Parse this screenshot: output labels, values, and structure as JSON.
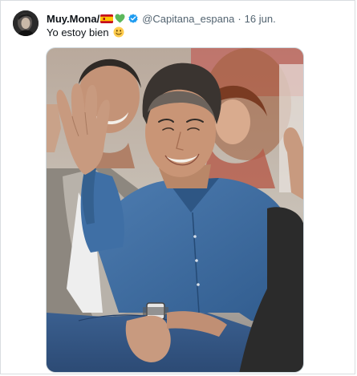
{
  "tweet": {
    "display_name": "Muy.Mona/",
    "handle": "@Capitana_espana",
    "separator": "·",
    "date": "16 jun.",
    "text": "Yo estoy bien",
    "name_emojis": [
      "spain-flag-emoji",
      "green-heart-emoji"
    ],
    "text_emoji": "slightly-smiling-face-emoji",
    "verified": true,
    "media_alt": "Photo of a smiling man in a blue denim shirt waving at the camera, seated among a crowd"
  },
  "colors": {
    "verified_blue": "#1d9bf0",
    "secondary_text": "#536471",
    "primary_text": "#0f1419",
    "green_heart": "#5cb85c",
    "denim_shirt": "#3e6ea3"
  }
}
